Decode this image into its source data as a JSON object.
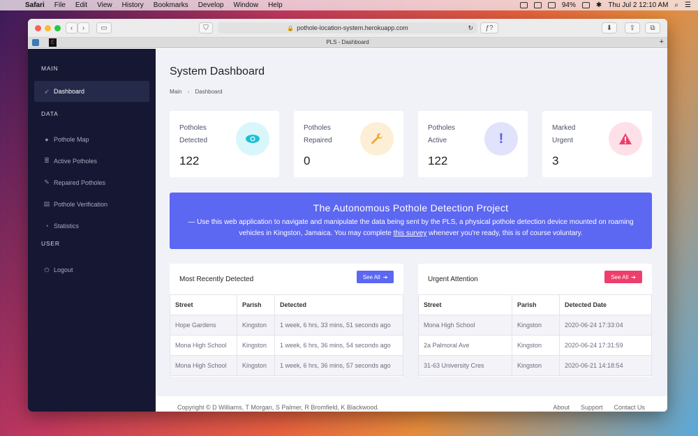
{
  "menubar": {
    "app": "Safari",
    "menus": [
      "File",
      "Edit",
      "View",
      "History",
      "Bookmarks",
      "Develop",
      "Window",
      "Help"
    ],
    "battery": "94%",
    "clock": "Thu Jul 2  12:10 AM"
  },
  "browser": {
    "url": "pothole-location-system.herokuapp.com",
    "tab_title": "PLS - Dashboard",
    "font_button": "ƒ?"
  },
  "sidebar": {
    "sections": [
      {
        "label": "MAIN",
        "items": [
          {
            "label": "Dashboard",
            "icon": "rocket-icon"
          }
        ]
      },
      {
        "label": "DATA",
        "items": [
          {
            "label": "Pothole Map",
            "icon": "map-pin-icon"
          },
          {
            "label": "Active Potholes",
            "icon": "database-icon"
          },
          {
            "label": "Repaired Potholes",
            "icon": "wrench-icon"
          },
          {
            "label": "Pothole Verification",
            "icon": "clipboard-icon"
          },
          {
            "label": "Statistics",
            "icon": "pie-chart-icon"
          }
        ]
      },
      {
        "label": "USER",
        "items": [
          {
            "label": "Logout",
            "icon": "power-icon"
          }
        ]
      }
    ]
  },
  "page": {
    "title": "System Dashboard",
    "breadcrumb": [
      "Main",
      "Dashboard"
    ]
  },
  "cards": [
    {
      "line1": "Potholes",
      "line2": "Detected",
      "value": "122",
      "icon": "eye-icon",
      "bg": "#d9f7fb",
      "fg": "#1fbfd6"
    },
    {
      "line1": "Potholes",
      "line2": "Repaired",
      "value": "0",
      "icon": "wrench-icon",
      "bg": "#fdefd6",
      "fg": "#f3a536"
    },
    {
      "line1": "Potholes",
      "line2": "Active",
      "value": "122",
      "icon": "exclamation-icon",
      "bg": "#e1e2fb",
      "fg": "#5860e6"
    },
    {
      "line1": "Marked",
      "line2": "Urgent",
      "value": "3",
      "icon": "warning-icon",
      "bg": "#fde0e8",
      "fg": "#ee3f6c"
    }
  ],
  "banner": {
    "title": "The Autonomous Pothole Detection Project",
    "text_before": "— Use this web application to navigate and manipulate the data being sent by the PLS, a physical pothole detection device mounted on roaming vehicles in Kingston, Jamaica. You may complete ",
    "link": "this survey",
    "text_after": " whenever you're ready, this is of course voluntary."
  },
  "recent": {
    "title": "Most Recently Detected",
    "see_all": "See All",
    "columns": [
      "Street",
      "Parish",
      "Detected"
    ],
    "rows": [
      [
        "Hope Gardens",
        "Kingston",
        "1 week, 6 hrs, 33 mins, 51 seconds ago"
      ],
      [
        "Mona High School",
        "Kingston",
        "1 week, 6 hrs, 36 mins, 54 seconds ago"
      ],
      [
        "Mona High School",
        "Kingston",
        "1 week, 6 hrs, 36 mins, 57 seconds ago"
      ]
    ]
  },
  "urgent": {
    "title": "Urgent Attention",
    "see_all": "See All",
    "columns": [
      "Street",
      "Parish",
      "Detected Date"
    ],
    "rows": [
      [
        "Mona High School",
        "Kingston",
        "2020-06-24 17:33:04"
      ],
      [
        "2a Palmoral Ave",
        "Kingston",
        "2020-06-24 17:31:59"
      ],
      [
        "31-63 University Cres",
        "Kingston",
        "2020-06-21 14:18:54"
      ]
    ]
  },
  "footer": {
    "copyright": "Copyright © D Williams, T Morgan, S Palmer, R Bromfield, K Blackwood.",
    "links": [
      "About",
      "Support",
      "Contact Us"
    ]
  },
  "colors": {
    "accent": "#5c67f2",
    "danger": "#ee3f6c",
    "sidebar": "#161833"
  }
}
